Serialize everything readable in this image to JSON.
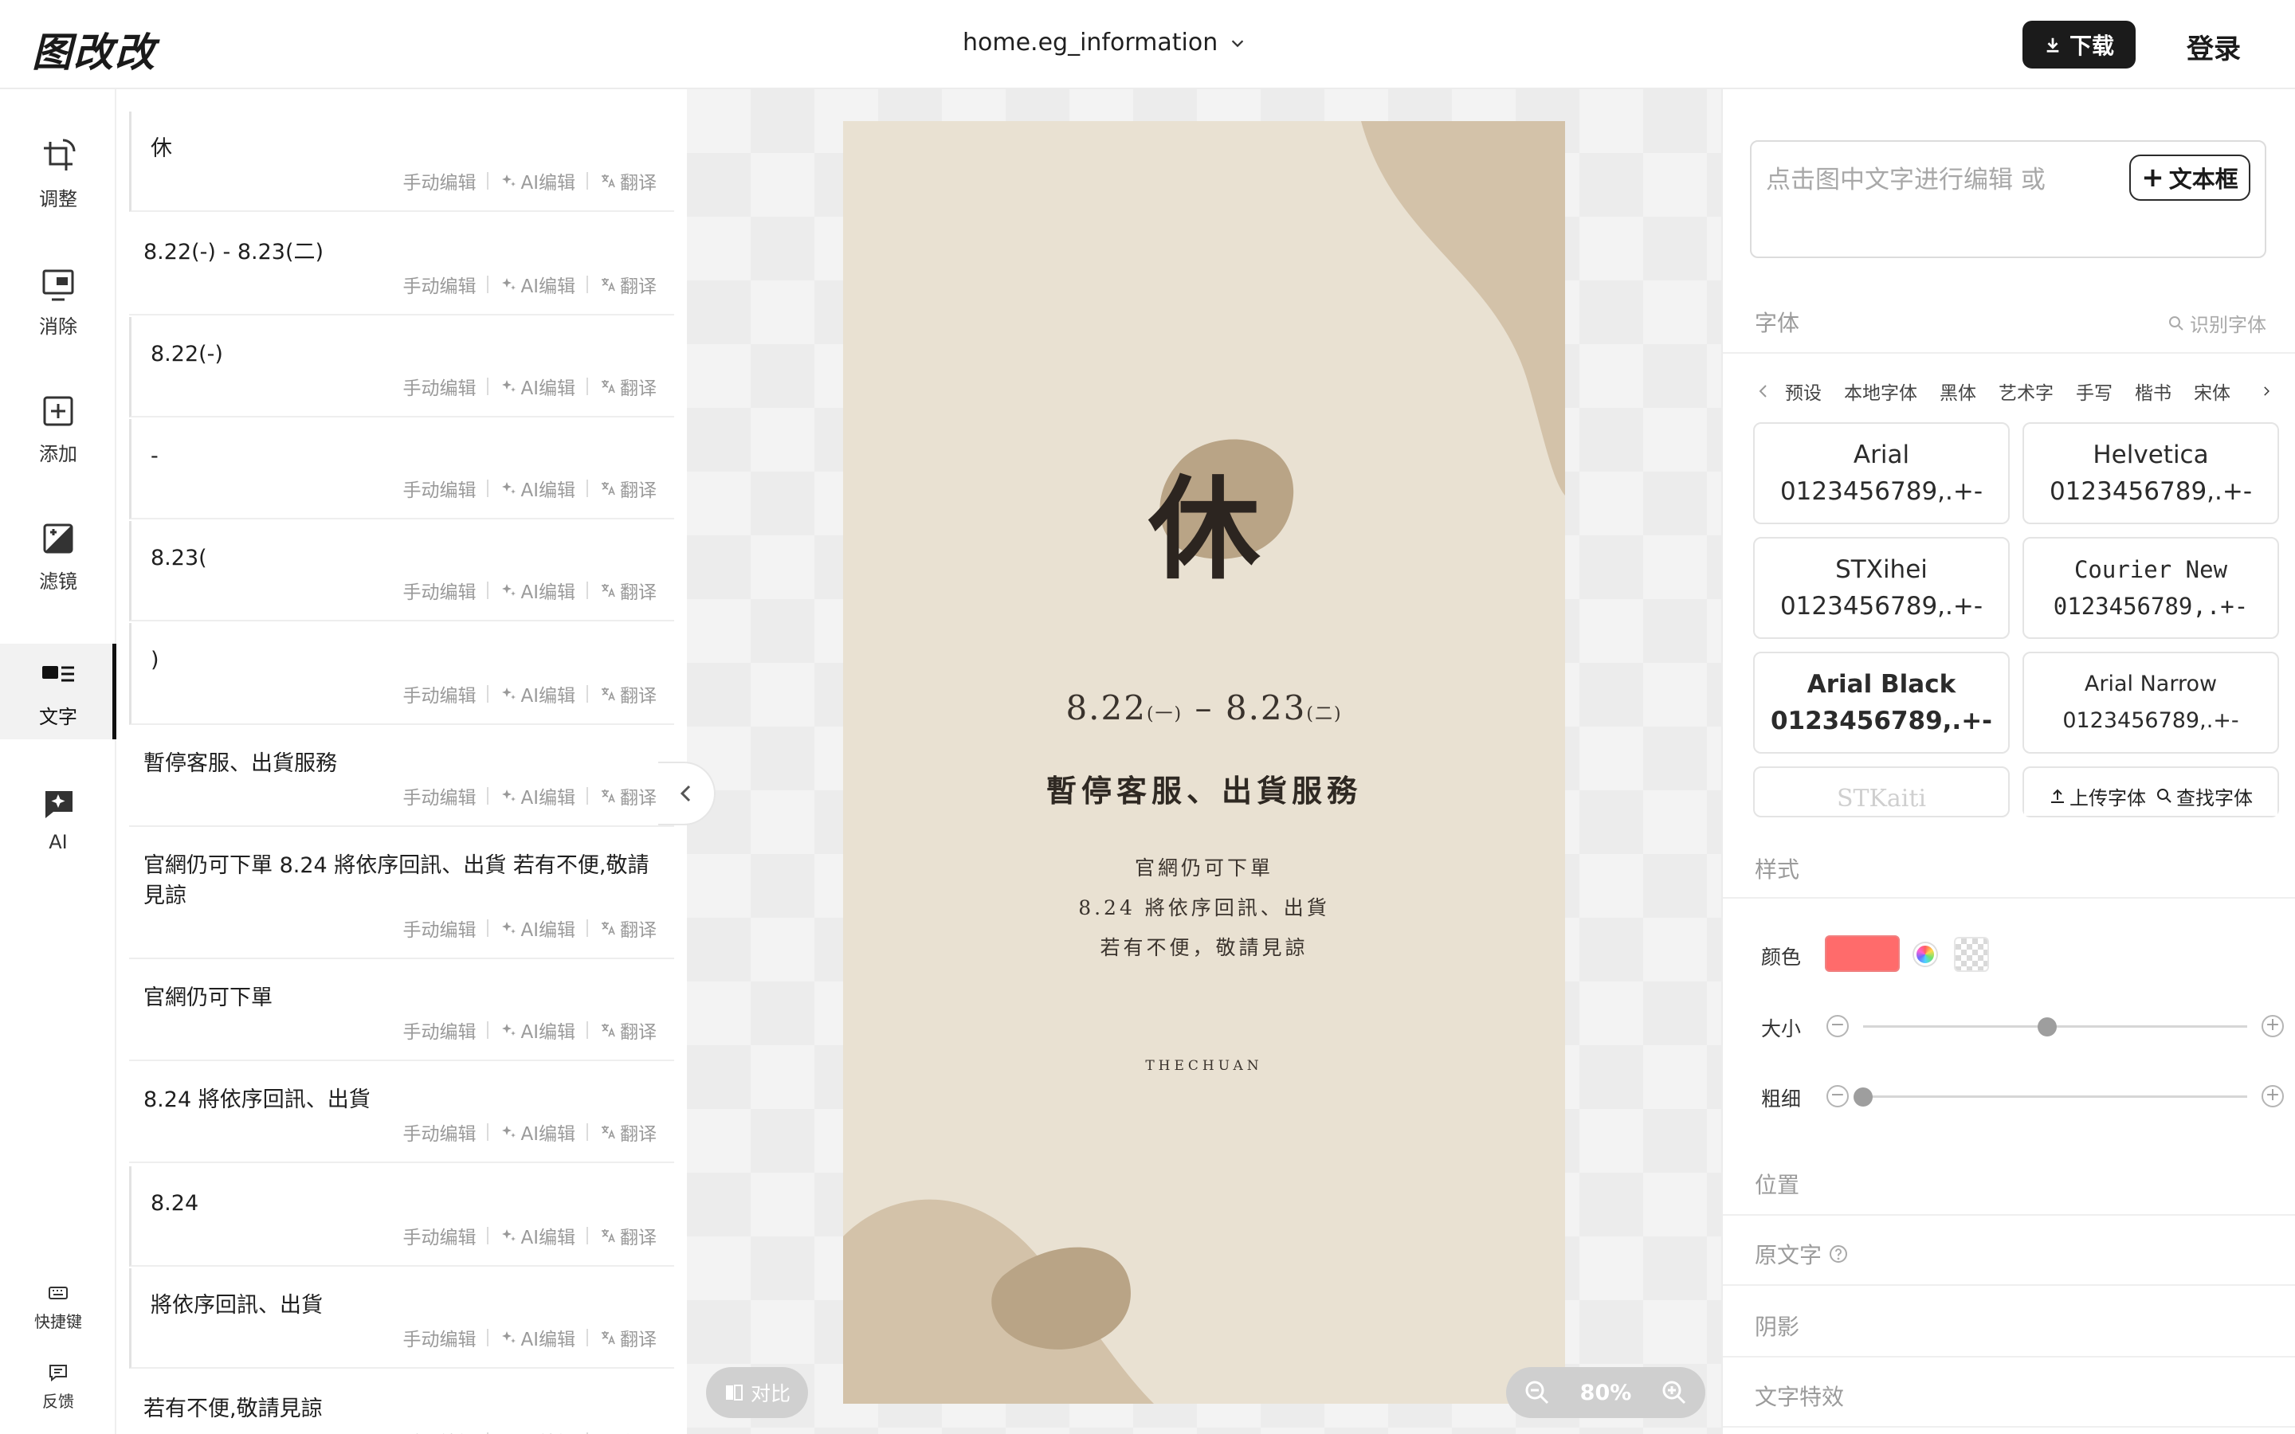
{
  "app": {
    "logo": "图改改",
    "file_name": "home.eg_information"
  },
  "header": {
    "download_label": "下载",
    "login_label": "登录"
  },
  "rail": {
    "items": [
      {
        "label": "调整",
        "icon": "adjust-icon"
      },
      {
        "label": "消除",
        "icon": "erase-icon"
      },
      {
        "label": "添加",
        "icon": "add-icon"
      },
      {
        "label": "滤镜",
        "icon": "filter-icon"
      },
      {
        "label": "文字",
        "icon": "text-icon",
        "active": true
      },
      {
        "label": "AI",
        "icon": "ai-icon"
      }
    ],
    "bottom": [
      {
        "label": "快捷键",
        "icon": "keyboard-icon"
      },
      {
        "label": "反馈",
        "icon": "feedback-icon"
      }
    ]
  },
  "text_list": {
    "actions": {
      "manual": "手动编辑",
      "ai": "AI编辑",
      "translate": "翻译"
    },
    "items": [
      "休",
      "8.22(-) - 8.23(二)",
      "8.22(-)",
      "-",
      "8.23(",
      ")",
      "暫停客服、出貨服務",
      "官網仍可下單 8.24 將依序回訊、出貨 若有不便,敬請見諒",
      "官網仍可下單",
      "8.24 將依序回訊、出貨",
      "8.24",
      "將依序回訊、出貨",
      "若有不便,敬請見諒"
    ]
  },
  "poster": {
    "char": "休",
    "date_a": "8.22",
    "date_a_small": "(一)",
    "date_dash": "–",
    "date_b": "8.23",
    "date_b_small": "(二)",
    "headline": "暫停客服、出貨服務",
    "lines": [
      "官網仍可下單",
      "8.24 將依序回訊、出貨",
      "若有不便，敬請見諒"
    ],
    "brand": "THECHUAN",
    "colors": {
      "paper": "#e9e1d2",
      "blob": "#d3c2a9",
      "blob_dark": "#b9a486"
    }
  },
  "canvas": {
    "compare_label": "对比",
    "zoom": "80%"
  },
  "props": {
    "placeholder": "点击图中文字进行编辑 或",
    "textbox_label": "文本框",
    "font_section": "字体",
    "detect_font": "识别字体",
    "font_tabs": [
      "预设",
      "本地字体",
      "黑体",
      "艺术字",
      "手写",
      "楷书",
      "宋体"
    ],
    "fonts": [
      {
        "name": "Arial",
        "sample": "0123456789,.+-"
      },
      {
        "name": "Helvetica",
        "sample": "0123456789,.+-"
      },
      {
        "name": "STXihei",
        "sample": "0123456789,.+-"
      },
      {
        "name": "Courier New",
        "sample": "0123456789,.+-"
      },
      {
        "name": "Arial Black",
        "sample": "0123456789,.+-"
      },
      {
        "name": "Arial Narrow",
        "sample": "0123456789,.+-"
      },
      {
        "name": "STKaiti",
        "sample": ""
      }
    ],
    "upload_font": "上传字体",
    "find_font": "查找字体",
    "style_section": "样式",
    "color_label": "颜色",
    "color_value": "#ff6b6b",
    "size_label": "大小",
    "size_level": 0.48,
    "weight_label": "粗细",
    "weight_level": 0.0,
    "position_section": "位置",
    "original_section": "原文字",
    "shadow_section": "阴影",
    "effect_section": "文字特效"
  }
}
